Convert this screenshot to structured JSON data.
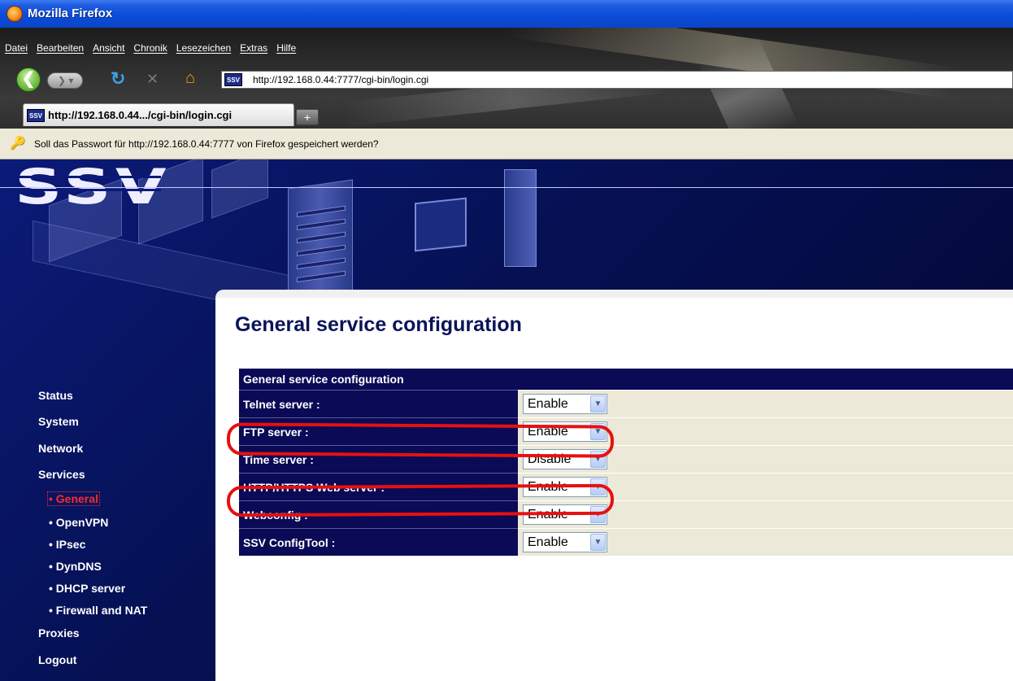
{
  "window": {
    "title": "Mozilla Firefox"
  },
  "menu": [
    "Datei",
    "Bearbeiten",
    "Ansicht",
    "Chronik",
    "Lesezeichen",
    "Extras",
    "Hilfe"
  ],
  "nav": {
    "url": "http://192.168.0.44:7777/cgi-bin/login.cgi",
    "favicon_text": "SSV"
  },
  "tab": {
    "title": "http://192.168.0.44.../cgi-bin/login.cgi",
    "new_tab": "+"
  },
  "notification": {
    "text": "Soll das Passwort für http://192.168.0.44:7777 von Firefox gespeichert werden?"
  },
  "brand": {
    "logo": "SSV"
  },
  "sidebar": {
    "items": [
      "Status",
      "System",
      "Network",
      "Services"
    ],
    "subitems": [
      "• General",
      "• OpenVPN",
      "• IPsec",
      "• DynDNS",
      "• DHCP server",
      "• Firewall and NAT"
    ],
    "items_after": [
      "Proxies",
      "Logout"
    ],
    "active": "• General",
    "active_color": "#ff2a2a"
  },
  "content": {
    "title": "General service configuration",
    "table_header": "General service configuration",
    "rows": [
      {
        "label": "Telnet server :",
        "value": "Enable"
      },
      {
        "label": "FTP server :",
        "value": "Enable",
        "highlighted": true
      },
      {
        "label": "Time server :",
        "value": "Disable"
      },
      {
        "label": "HTTP/HTTPS Web server :",
        "value": "Enable",
        "highlighted": true
      },
      {
        "label": "Webconfig :",
        "value": "Enable"
      },
      {
        "label": "SSV ConfigTool :",
        "value": "Enable"
      }
    ]
  },
  "colors": {
    "nav_bg": "#0a0a56",
    "highlight": "#e81010",
    "value_bg": "#ece9d8"
  }
}
